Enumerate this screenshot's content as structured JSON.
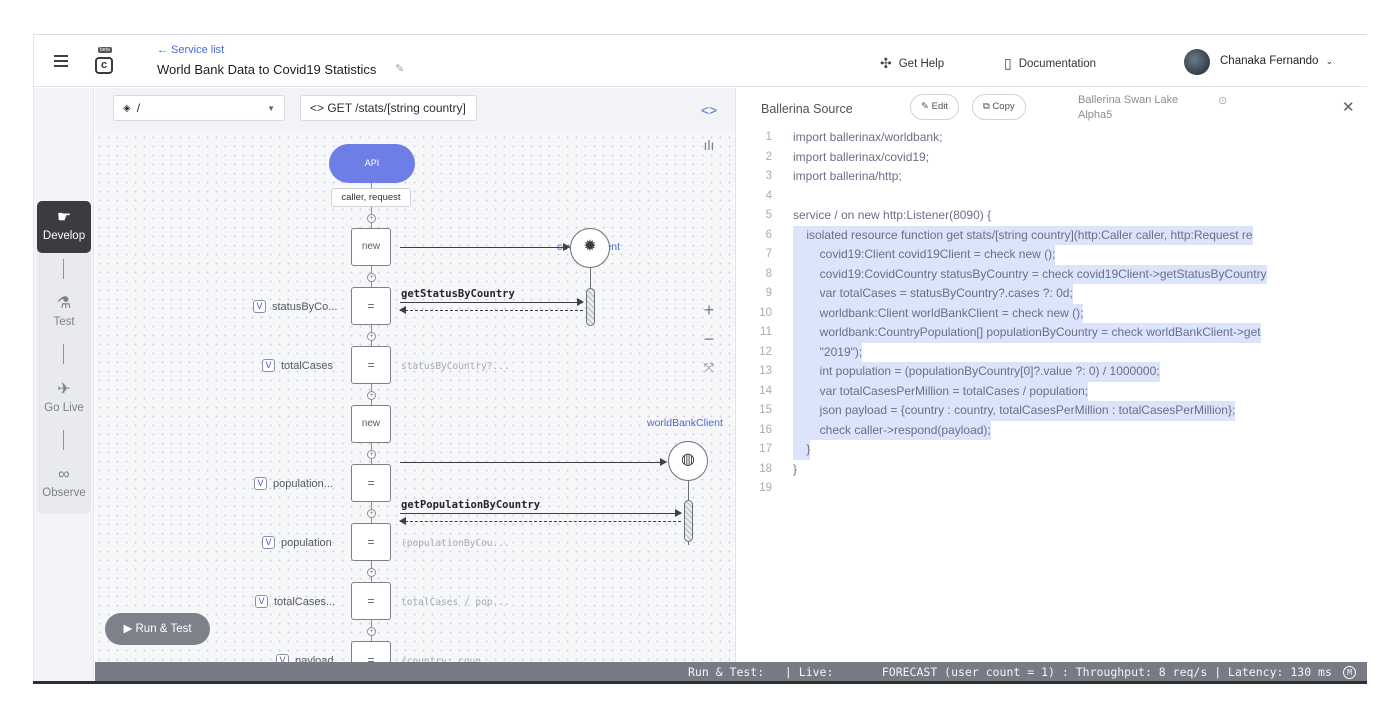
{
  "header": {
    "breadcrumb": "← Service list",
    "title": "World Bank Data to Covid19 Statistics",
    "logo_badge": "beta",
    "help_label": "Get Help",
    "docs_label": "Documentation",
    "user_name": "Chanaka Fernando"
  },
  "nav": [
    {
      "label": "Develop",
      "icon": "pointer-icon",
      "active": true
    },
    {
      "label": "Test",
      "icon": "flask-icon",
      "active": false
    },
    {
      "label": "Go Live",
      "icon": "rocket-icon",
      "active": false
    },
    {
      "label": "Observe",
      "icon": "binoculars-icon",
      "active": false
    }
  ],
  "diagram": {
    "path_select": "/",
    "resource_select": "<> GET /stats/[string country]",
    "api_label": "API",
    "params_label": "caller, request",
    "endpoint1": "covid19Client",
    "endpoint2": "worldBankClient",
    "nodes": [
      "new",
      "=",
      "=",
      "new",
      "=",
      "=",
      "=",
      "="
    ],
    "var_labels": [
      "statusByCo...",
      "totalCases",
      "population...",
      "population",
      "totalCases...",
      "payload"
    ],
    "ghost_exprs": [
      "statusByCountry?...",
      "(populationByCou...",
      "totalCases / pop...",
      "{country: coun..."
    ],
    "call1": "getStatusByCountry",
    "call2": "getPopulationByCountry",
    "run_test": "Run & Test"
  },
  "source": {
    "title": "Ballerina Source",
    "edit_label": "Edit",
    "copy_label": "Copy",
    "version_line1": "Ballerina Swan Lake",
    "version_line2": "Alpha5",
    "lines": [
      "import ballerinax/worldbank;",
      "import ballerinax/covid19;",
      "import ballerina/http;",
      "",
      "service / on new http:Listener(8090) {",
      "    isolated resource function get stats/[string country](http:Caller caller, http:Request re",
      "        covid19:Client covid19Client = check new ();",
      "        covid19:CovidCountry statusByCountry = check covid19Client->getStatusByCountry",
      "        var totalCases = statusByCountry?.cases ?: 0d;",
      "        worldbank:Client worldBankClient = check new ();",
      "        worldbank:CountryPopulation[] populationByCountry = check worldBankClient->get",
      "        \"2019\");",
      "        int population = (populationByCountry[0]?.value ?: 0) / 1000000;",
      "        var totalCasesPerMillion = totalCases / population;",
      "        json payload = {country : country, totalCasesPerMillion : totalCasesPerMillion};",
      "        check caller->respond(payload);",
      "    }",
      "}",
      ""
    ],
    "line_numbers": [
      "1",
      "2",
      "3",
      "4",
      "5",
      "6",
      "7",
      "8",
      "9",
      "10",
      "11",
      "12",
      "13",
      "14",
      "15",
      "16",
      "17",
      "18",
      "19"
    ]
  },
  "status_bar": "Run & Test:   | Live:       FORECAST (user count = 1) : Throughput: 8 req/s | Latency: 130 ms"
}
